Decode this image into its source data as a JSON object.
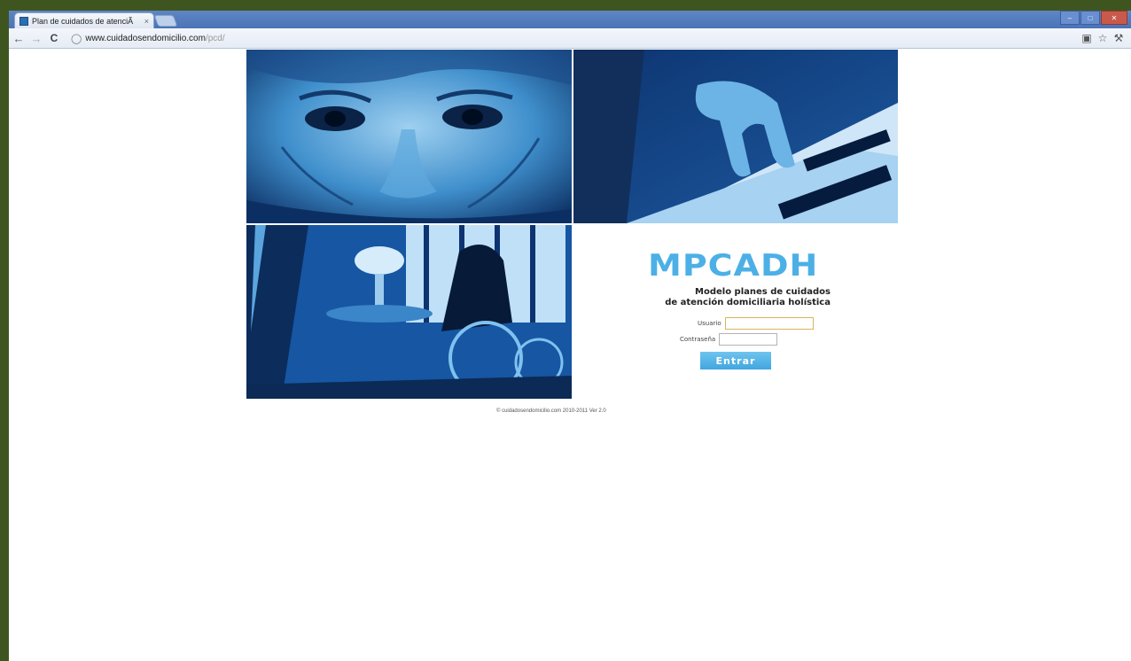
{
  "browser": {
    "tab_title": "Plan de cuidados de atenciÃ",
    "tab_close": "×",
    "url_host": "www.cuidadosendomicilio.com",
    "url_path": "/pcd/",
    "nav": {
      "back": "←",
      "forward": "→",
      "reload": "C"
    }
  },
  "login": {
    "logo_text": "MPCADH",
    "subtitle_line1": "Modelo planes de cuidados",
    "subtitle_line2": "de atención domiciliaria holística",
    "user_label": "Usuario",
    "password_label": "Contraseña",
    "submit_label": "Entrar",
    "user_value": "",
    "password_value": ""
  },
  "footer": {
    "copyright": "© cuidadosendomicilio.com 2010-2011 Ver 2.0"
  },
  "photos": [
    {
      "name": "elderly-face-photo"
    },
    {
      "name": "hands-reading-braille-photo"
    },
    {
      "name": "wheelchair-window-photo"
    }
  ],
  "colors": {
    "frame": "#3f5520",
    "logo": "#4cb0e6",
    "button": "#41a6df"
  }
}
